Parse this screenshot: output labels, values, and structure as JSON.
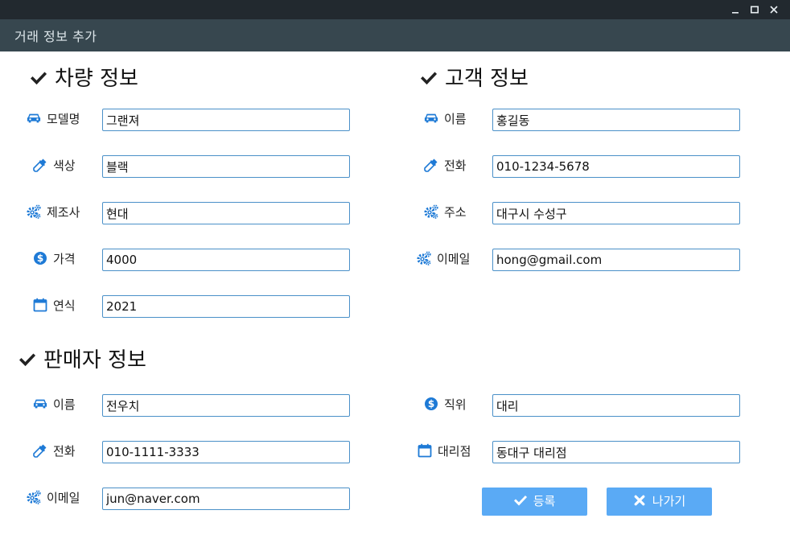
{
  "window": {
    "title": "거래 정보 추가"
  },
  "vehicle": {
    "title": "차량 정보",
    "fields": {
      "model": {
        "label": "모델명",
        "value": "그랜져",
        "icon": "car-icon"
      },
      "color": {
        "label": "색상",
        "value": "블랙",
        "icon": "eyedropper-icon"
      },
      "maker": {
        "label": "제조사",
        "value": "현대",
        "icon": "gears-icon"
      },
      "price": {
        "label": "가격",
        "value": "4000",
        "icon": "dollar-icon"
      },
      "year": {
        "label": "연식",
        "value": "2021",
        "icon": "calendar-icon"
      }
    }
  },
  "customer": {
    "title": "고객 정보",
    "fields": {
      "name": {
        "label": "이름",
        "value": "홍길동",
        "icon": "car-icon"
      },
      "phone": {
        "label": "전화",
        "value": "010-1234-5678",
        "icon": "eyedropper-icon"
      },
      "address": {
        "label": "주소",
        "value": "대구시 수성구",
        "icon": "gears-icon"
      },
      "email": {
        "label": "이메일",
        "value": "hong@gmail.com",
        "icon": "gears-icon"
      }
    }
  },
  "seller": {
    "title": "판매자 정보",
    "fields": {
      "name": {
        "label": "이름",
        "value": "전우치",
        "icon": "car-icon"
      },
      "phone": {
        "label": "전화",
        "value": "010-1111-3333",
        "icon": "eyedropper-icon"
      },
      "email": {
        "label": "이메일",
        "value": "jun@naver.com",
        "icon": "gears-icon"
      },
      "position": {
        "label": "직위",
        "value": "대리",
        "icon": "dollar-icon"
      },
      "branch": {
        "label": "대리점",
        "value": "동대구 대리점",
        "icon": "calendar-icon"
      }
    }
  },
  "buttons": {
    "register": {
      "label": "등록",
      "icon": "check-icon"
    },
    "exit": {
      "label": "나가기",
      "icon": "x-icon"
    }
  },
  "colors": {
    "accent": "#1e7ad6",
    "button": "#5aaaf5",
    "titlebar": "#22292f",
    "header": "#37474f",
    "input_border": "#4a90c8"
  }
}
